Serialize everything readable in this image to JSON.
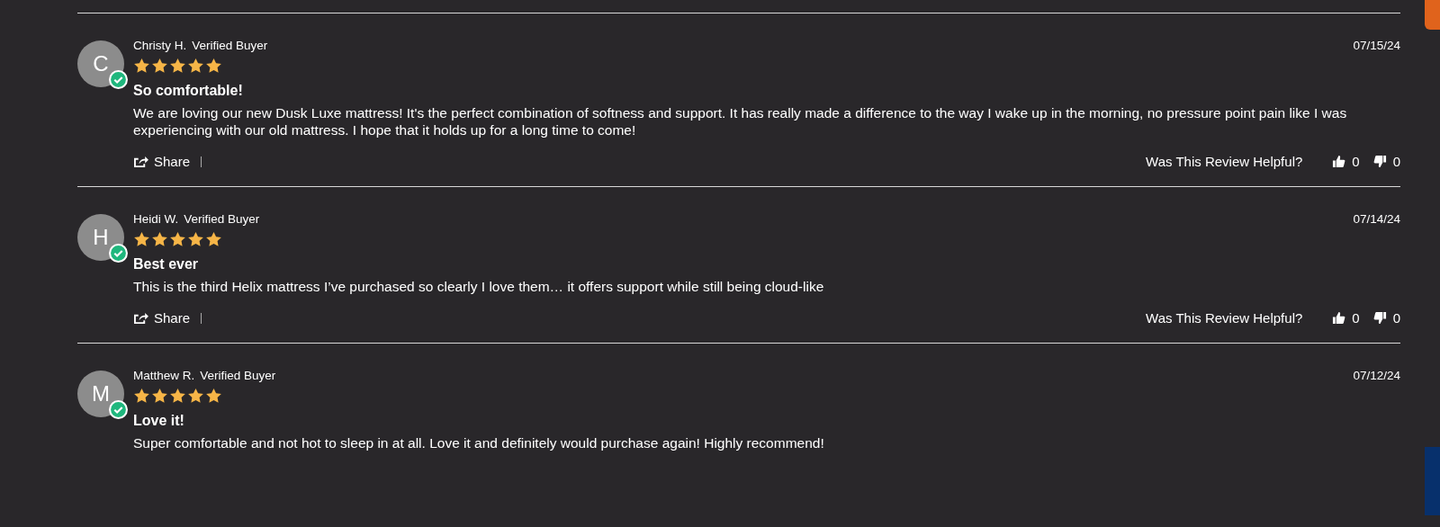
{
  "reviews": [
    {
      "initial": "C",
      "name": "Christy H.",
      "badge": "Verified Buyer",
      "verified": true,
      "stars": 5,
      "date": "07/15/24",
      "title": "So comfortable!",
      "body": "We are loving our new Dusk Luxe mattress! It's the perfect combination of softness and support. It has really made a difference to the way I wake up in the morning, no pressure point pain like I was experiencing with our old mattress. I hope that it holds up for a long time to come!",
      "share": "Share",
      "helpful": "Was This Review Helpful?",
      "up": "0",
      "down": "0"
    },
    {
      "initial": "H",
      "name": "Heidi W.",
      "badge": "Verified Buyer",
      "verified": true,
      "stars": 5,
      "date": "07/14/24",
      "title": "Best ever",
      "body": "This is the third Helix mattress I’ve purchased so clearly I love them… it offers support while still being cloud-like",
      "share": "Share",
      "helpful": "Was This Review Helpful?",
      "up": "0",
      "down": "0"
    },
    {
      "initial": "M",
      "name": "Matthew R.",
      "badge": "Verified Buyer",
      "verified": true,
      "stars": 5,
      "date": "07/12/24",
      "title": "Love it!",
      "body": "Super comfortable and not hot to sleep in at all. Love it and definitely would purchase again! Highly recommend!"
    }
  ]
}
